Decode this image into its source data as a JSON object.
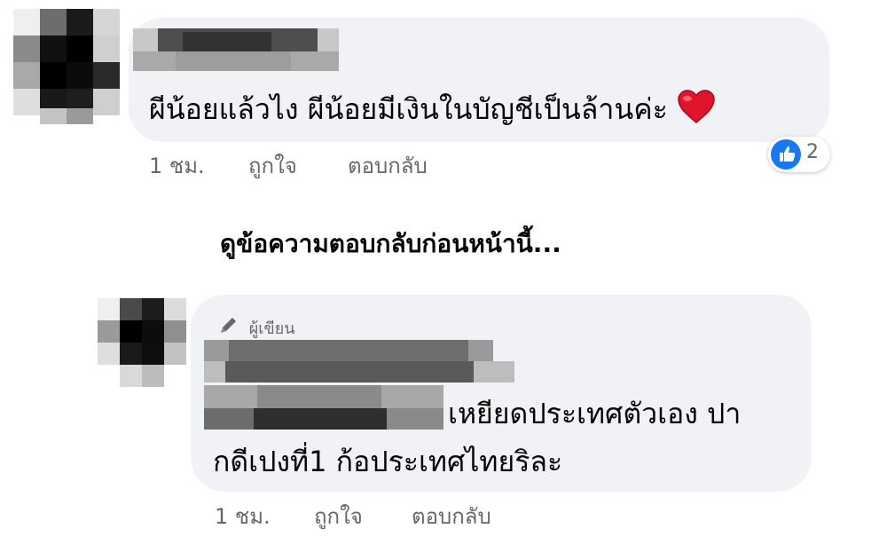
{
  "comment": {
    "text": "ผีน้อยแล้วไง ผีน้อยมีเงินในบัญชีเป็นล้านค่ะ",
    "heart_emoji": "❤",
    "time": "1 ชม.",
    "like_label": "ถูกใจ",
    "reply_label": "ตอบกลับ",
    "reaction_count": "2",
    "colors": {
      "like_blue": "#1877f2",
      "heart_red": "#e0142b"
    },
    "icons": [
      "like-icon",
      "heart-emoji"
    ]
  },
  "view_previous_replies": "ดูข้อความตอบกลับก่อนหน้านี้...",
  "reply": {
    "author_badge": "ผู้เขียน",
    "badge_icon": "pencil-icon",
    "text_line1": "เหยียดประเทศตัวเอง ปา",
    "text_line2": "กดีเปงที่1 ก้อประเทศไทยริละ",
    "time": "1 ชม.",
    "like_label": "ถูกใจ",
    "reply_label": "ตอบกลับ"
  }
}
